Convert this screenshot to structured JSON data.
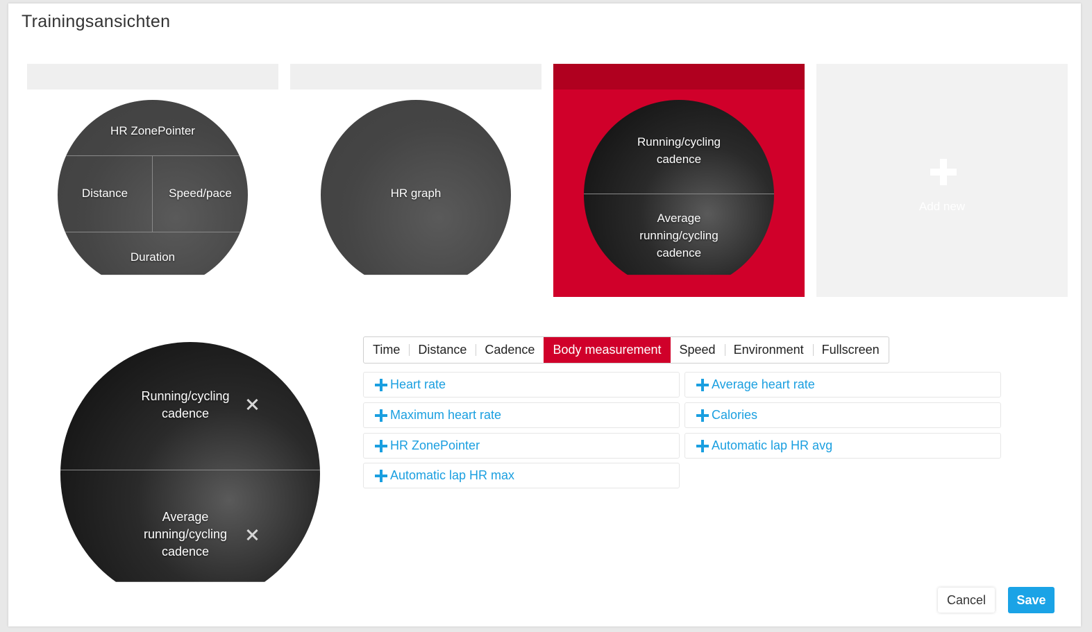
{
  "title": "Trainingsansichten",
  "views": [
    {
      "fields": {
        "top": "HR ZonePointer",
        "left": "Distance",
        "right": "Speed/pace",
        "bottom": "Duration"
      }
    },
    {
      "fields": {
        "center": "HR graph"
      }
    },
    {
      "fields": {
        "top": "Running/cycling\ncadence",
        "bottom": "Average\nrunning/cycling\ncadence"
      },
      "active": true
    },
    {
      "add_new_label": "Add new"
    }
  ],
  "editor": {
    "top_field": "Running/cycling\ncadence",
    "bottom_field": "Average\nrunning/cycling\ncadence",
    "remove_icon": "close-icon"
  },
  "tabs": [
    "Time",
    "Distance",
    "Cadence",
    "Body measurement",
    "Speed",
    "Environment",
    "Fullscreen"
  ],
  "active_tab": "Body measurement",
  "items": [
    "Heart rate",
    "Average heart rate",
    "Maximum heart rate",
    "Calories",
    "HR ZonePointer",
    "Automatic lap HR avg",
    "Automatic lap HR max"
  ],
  "item_icon": "plus-icon",
  "buttons": {
    "cancel": "Cancel",
    "save": "Save"
  },
  "colors": {
    "accent_red": "#d0002a",
    "link_blue": "#1a9fe0",
    "save_blue": "#1aa3e6"
  }
}
